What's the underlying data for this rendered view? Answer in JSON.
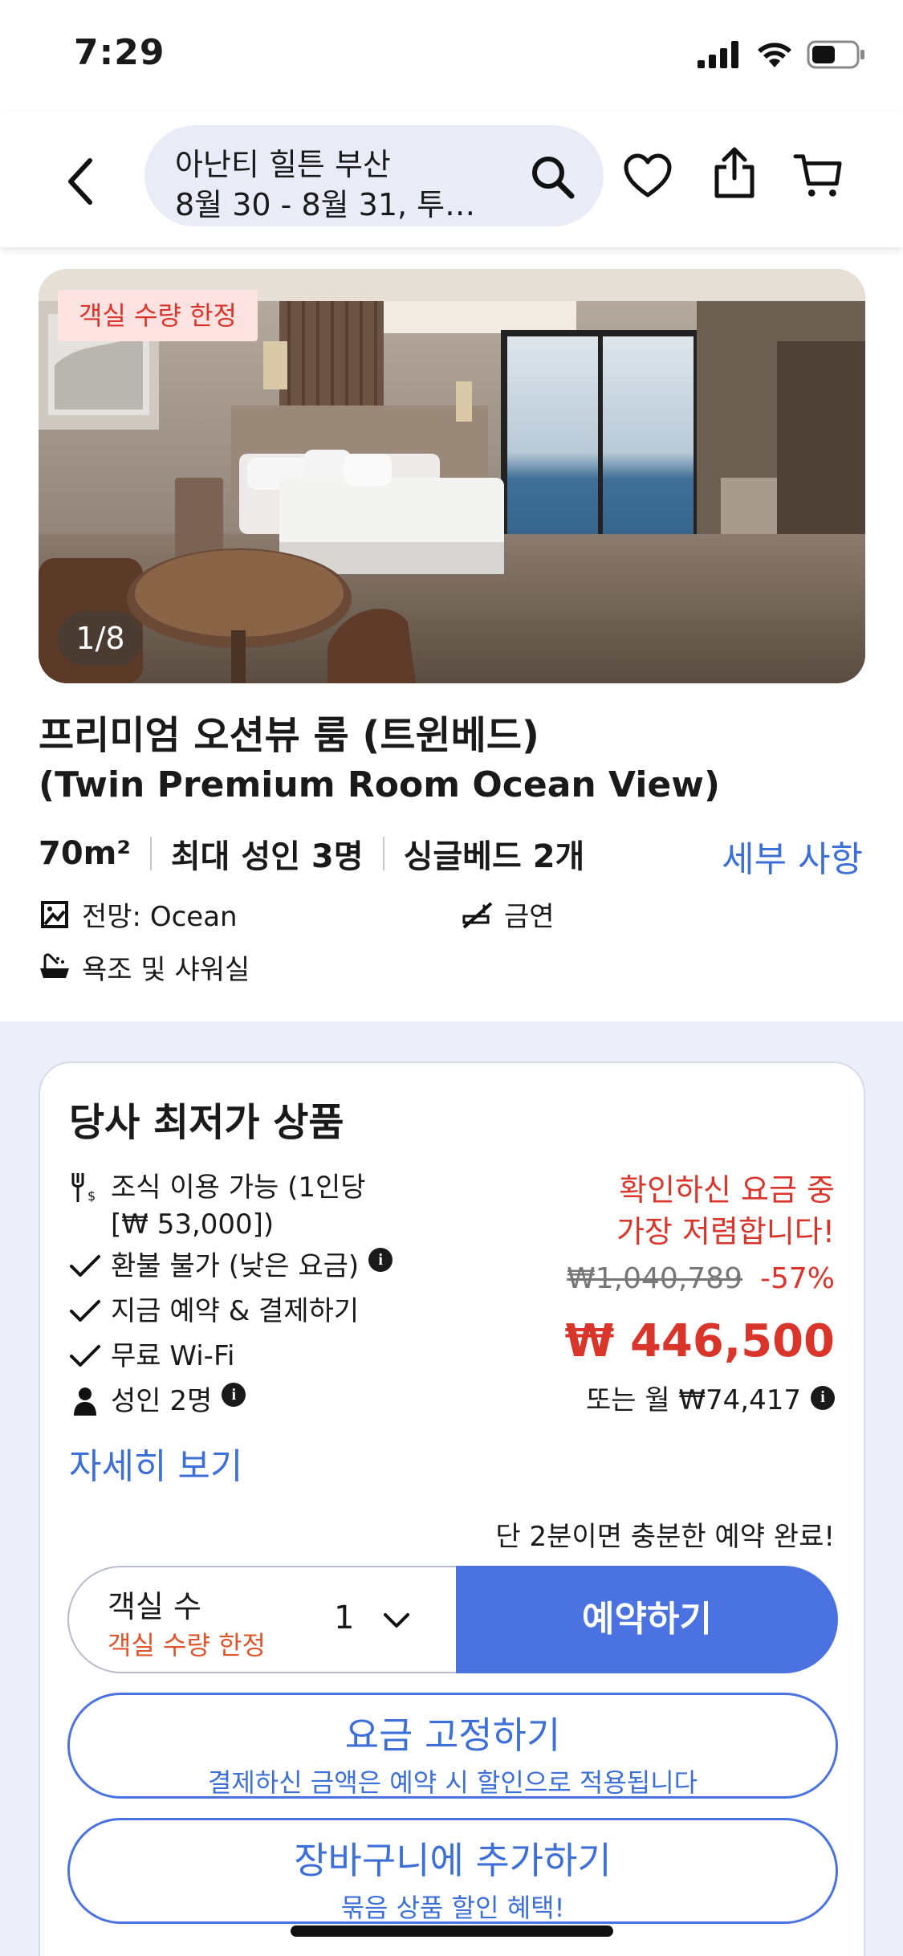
{
  "status_bar": {
    "time": "7:29"
  },
  "header": {
    "search_title": "아난티 힐튼 부산",
    "search_subtitle": "8월 30 - 8월 31, 투…"
  },
  "photo": {
    "badge": "객실 수량 한정",
    "counter": "1/8"
  },
  "room": {
    "title_ko": "프리미엄 오션뷰 룸 (트윈베드)",
    "title_en": "(Twin Premium Room Ocean View)",
    "size": "70m²",
    "max_guests": "최대 성인 3명",
    "beds": "싱글베드 2개",
    "details_link": "세부 사항",
    "features": {
      "view": "전망: Ocean",
      "smoking": "금연",
      "bath": "욕조 및 샤워실"
    }
  },
  "offer": {
    "title": "당사 최저가 상품",
    "amenities": {
      "breakfast_line1": "조식 이용 가능 (1인당",
      "breakfast_line2": "[₩ 53,000])",
      "refund": "환불 불가 (낮은 요금)",
      "pay_now": "지금 예약 & 결제하기",
      "wifi": "무료 Wi-Fi",
      "guests": "성인 2명"
    },
    "more_link": "자세히 보기",
    "promo_line1": "확인하신 요금 중",
    "promo_line2": "가장 저렴합니다!",
    "old_price": "₩1,040,789",
    "discount": "-57%",
    "price": "₩ 446,500",
    "monthly": "또는 월 ₩74,417",
    "quick_note": "단 2분이면 충분한 예약 완료!",
    "rooms_label": "객실 수",
    "rooms_limited": "객실 수량 한정",
    "rooms_count": "1",
    "book_button": "예약하기",
    "lock_main": "요금 고정하기",
    "lock_sub": "결제하신 금액은 예약 시 할인으로 적용됩니다",
    "cart_main": "장바구니에 추가하기",
    "cart_sub": "묶음 상품 할인 혜택!"
  },
  "colors": {
    "accent_blue": "#4a72e0",
    "price_red": "#d9352b",
    "page_bg_gray": "#eceff8"
  }
}
